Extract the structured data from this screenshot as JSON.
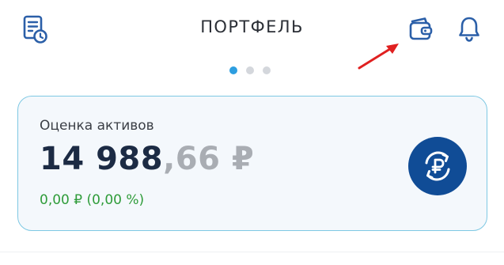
{
  "header": {
    "title": "ПОРТФЕЛЬ",
    "left_icon": "history-document-icon",
    "right_icons": [
      "wallet-icon",
      "bell-icon"
    ]
  },
  "pager": {
    "count": 3,
    "active_index": 0
  },
  "portfolio_card": {
    "label": "Оценка активов",
    "amount_integer": "14 988",
    "amount_fraction": ",66 ₽",
    "change": "0,00 ₽ (0,00 %)",
    "action_icon": "ruble-exchange-icon"
  },
  "annotation": {
    "icon": "red-arrow",
    "color": "#e02020"
  },
  "colors": {
    "accent_blue": "#2d9ee0",
    "icon_blue": "#2b5fa8",
    "dark_navy": "#104c96",
    "positive_green": "#2f9c3a",
    "card_border": "#7ec8e3",
    "card_bg": "#f4f8fc"
  }
}
